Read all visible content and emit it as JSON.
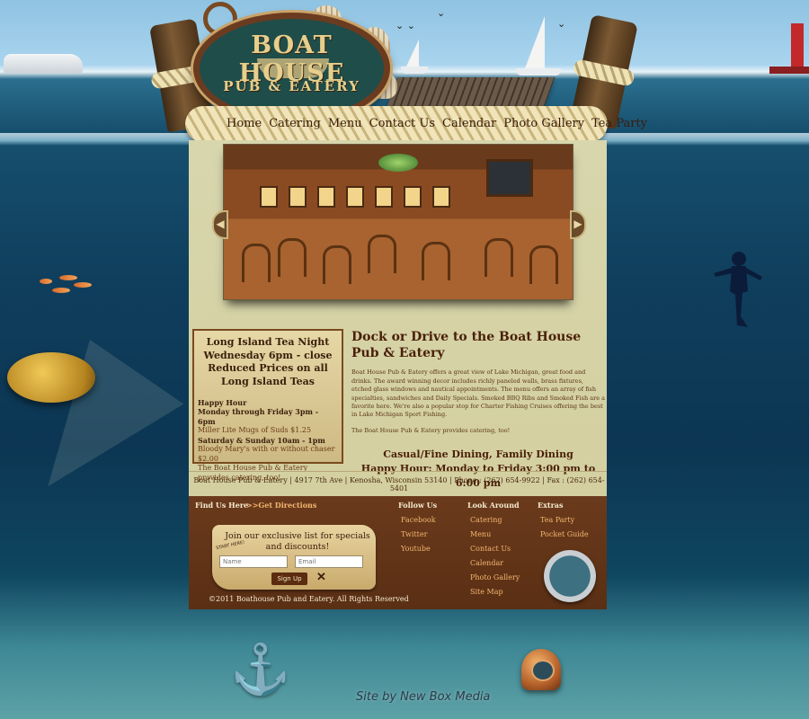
{
  "logo": {
    "line1": "BOAT HOUSE",
    "line2": "PUB & EATERY"
  },
  "nav": {
    "items": [
      "Home",
      "Catering",
      "Menu",
      "Contact Us",
      "Calendar",
      "Photo Gallery",
      "Tea Party"
    ]
  },
  "hero": {
    "prev_arrow": "◀",
    "next_arrow": "▶"
  },
  "promo": {
    "title_lines": [
      "Long Island Tea Night",
      "Wednesday 6pm - close",
      "Reduced Prices on all Long Island Teas"
    ],
    "happy_hour_title": "Happy Hour",
    "weekday_hours": "Monday through Friday 3pm - 6pm",
    "weekday_deal": "Miller Lite Mugs of Suds $1.25",
    "weekend_hours": "Saturday & Sunday 10am - 1pm",
    "weekend_deal": "Bloody Mary's with or without chaser $2.00",
    "catering_note": "The Boat House Pub & Eatery provides catering, too!"
  },
  "main": {
    "heading": "Dock or Drive to the Boat House Pub & Eatery",
    "body": "Boat House Pub & Eatery offers a great view of Lake Michigan, great food and drinks. The award winning decor includes richly paneled walls, brass fixtures, etched glass windows and nautical appointments. The menu offers an array of fish specialties, sandwiches and Daily Specials. Smoked BBQ Ribs and Smoked Fish are a favorite here. We're also a popular stop for Charter Fishing Cruises offering the best in Lake Michigan Sport Fishing.",
    "catering": "The Boat House Pub & Eatery provides catering, too!",
    "tagline": "Casual/Fine Dining, Family Dining",
    "happy_hour": "Happy Hour: Monday to Friday 3:00 pm to 6:00 pm"
  },
  "address": "Boat House Pub & Eatery | 4917 7th Ave | Kenosha, Wisconsin 53140 | Phone : (262) 654-9922 | Fax : (262) 654-5401",
  "footer": {
    "find_us": "Find Us Here",
    "directions": ">>Get Directions",
    "signup_text": "Join our exclusive list for specials and discounts!",
    "name_placeholder": "Name",
    "email_placeholder": "Email",
    "signup_button": "Sign Up",
    "start_label": "START HERE!",
    "copyright": "©2011 Boathouse Pub and Eatery. All Rights Reserved",
    "follow": {
      "title": "Follow Us",
      "links": [
        "Facebook",
        "Twitter",
        "Youtube"
      ]
    },
    "look": {
      "title": "Look Around",
      "links": [
        "Catering",
        "Menu",
        "Contact Us",
        "Calendar",
        "Photo Gallery",
        "Site Map"
      ]
    },
    "extras": {
      "title": "Extras",
      "links": [
        "Tea Party",
        "Pocket Guide"
      ]
    }
  },
  "credit": "Site by New Box Media",
  "colors": {
    "panel": "#d8d6ad",
    "footer": "#6b3a1c",
    "link": "#f2b66f",
    "heading": "#4a1f08"
  }
}
